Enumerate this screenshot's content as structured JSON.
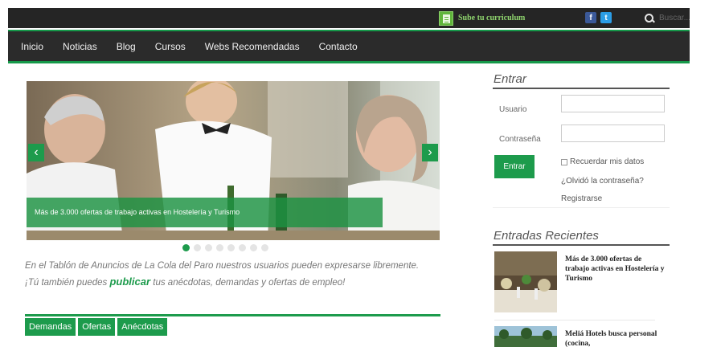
{
  "topbar": {
    "cv_label": "Sube tu curriculum",
    "social": {
      "facebook_letter": "f",
      "twitter_letter": "t"
    },
    "search_placeholder": "Buscar..."
  },
  "nav": {
    "items": [
      {
        "label": "Inicio"
      },
      {
        "label": "Noticias"
      },
      {
        "label": "Blog"
      },
      {
        "label": "Cursos"
      },
      {
        "label": "Webs Recomendadas"
      },
      {
        "label": "Contacto"
      }
    ]
  },
  "slider": {
    "prev_glyph": "‹",
    "next_glyph": "›",
    "caption": "Más de 3.000 ofertas de trabajo activas en Hostelería y Turismo",
    "slide_count": 8,
    "active_slide": 1
  },
  "intro": {
    "line1": "En el Tablón de Anuncios de La Cola del Paro nuestros usuarios pueden expresarse libremente.",
    "line2_before": "¡Tú también puedes ",
    "line2_highlight": "publicar",
    "line2_after": " tus anécdotas, demandas y ofertas de empleo!"
  },
  "tabs": [
    {
      "label": "Demandas"
    },
    {
      "label": "Ofertas"
    },
    {
      "label": "Anécdotas"
    }
  ],
  "login": {
    "title": "Entrar",
    "username_label": "Usuario",
    "password_label": "Contraseña",
    "submit_label": "Entrar",
    "remember_label": "Recuerdar mis datos",
    "forgot_label": "¿Olvidó la contraseña?",
    "register_label": "Registrarse"
  },
  "recent": {
    "title": "Entradas Recientes",
    "posts": [
      {
        "title": "Más de 3.000 ofertas de trabajo activas en Hostelería y Turismo"
      },
      {
        "title": "Meliá Hotels busca personal (cocina,"
      }
    ]
  },
  "colors": {
    "brand_green": "#1d9b4c",
    "topbar_bg": "#252525",
    "nav_bg": "#2b2b2b"
  }
}
